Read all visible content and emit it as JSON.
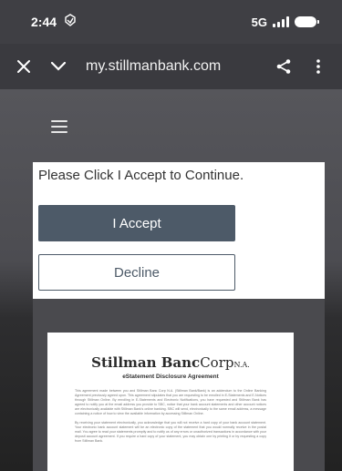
{
  "status_bar": {
    "time": "2:44",
    "network": "5G"
  },
  "browser": {
    "url": "my.stillmanbank.com"
  },
  "consent": {
    "prompt": "Please Click I Accept to Continue.",
    "accept_label": "I Accept",
    "decline_label": "Decline"
  },
  "document": {
    "brand_name": "Stillman Banc",
    "brand_corp": "Corp",
    "brand_suffix": "N.A.",
    "title": "eStatement Disclosure Agreement",
    "paragraph_1": "This agreement made between you and Stillman Banc Corp N.A. (Stillman Bank/Bank) is an addendum to the Online Banking Agreement previously agreed upon. This agreement stipulates that you are requesting to be enrolled in E-Statements and E-Notices through Stillman Online. By enrolling in E-Statements and Electronic Notifications, you have requested and Stillman Bank has agreed to notify you at the email address you provide to SBC, notice that your bank account statements and other account notices are electronically available with Stillman Bank's online banking. SBC will send, electronically to the same email address, a message containing a notice of how to view the available information by accessing Stillman Online.",
    "paragraph_2": "By receiving your statement electronically, you acknowledge that you will not receive a hard copy of your bank account statement. Your electronic bank account statement will be an electronic copy of the statement that you would normally receive in the postal mail. You agree to read your statements promptly and to notify us of any errors or unauthorized transactions in accordance with your deposit account agreement. If you require a hard copy of your statement, you may obtain one by printing it or by requesting a copy from Stillman Bank."
  }
}
